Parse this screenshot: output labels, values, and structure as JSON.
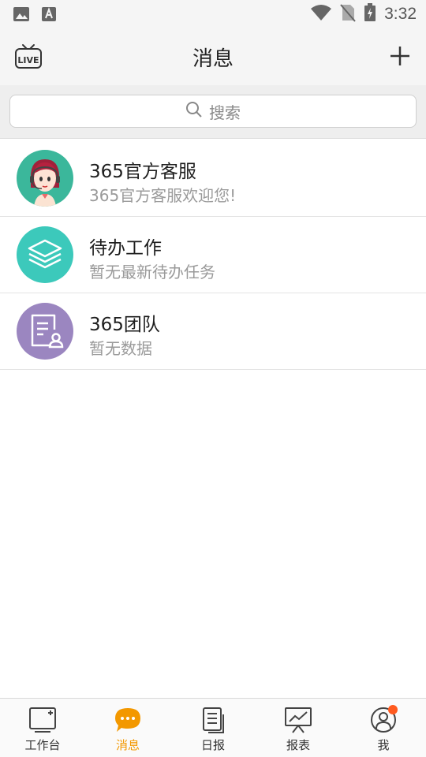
{
  "status_bar": {
    "time": "3:32",
    "icons": [
      "image-icon",
      "text-a-icon",
      "wifi-icon",
      "no-sim-icon",
      "battery-charging-icon"
    ]
  },
  "app_bar": {
    "title": "消息",
    "left_icon": "live-tv-icon",
    "right_icon": "plus-icon"
  },
  "search": {
    "placeholder": "搜索"
  },
  "conversations": [
    {
      "name": "365官方客服",
      "preview": "365官方客服欢迎您!",
      "avatar": "customer-service-avatar",
      "color": "#3bb79b"
    },
    {
      "name": "待办工作",
      "preview": "暂无最新待办任务",
      "avatar": "layers-icon",
      "color": "#3cc9bb"
    },
    {
      "name": "365团队",
      "preview": "暂无数据",
      "avatar": "team-document-icon",
      "color": "#9b86c0"
    }
  ],
  "tabs": [
    {
      "label": "工作台",
      "icon": "workbench-icon",
      "active": false
    },
    {
      "label": "消息",
      "icon": "chat-bubble-icon",
      "active": true
    },
    {
      "label": "日报",
      "icon": "daily-report-icon",
      "active": false
    },
    {
      "label": "报表",
      "icon": "chart-report-icon",
      "active": false
    },
    {
      "label": "我",
      "icon": "profile-icon",
      "active": false,
      "badge": true
    }
  ],
  "colors": {
    "accent": "#f39800",
    "badge": "#ff5a1f"
  }
}
